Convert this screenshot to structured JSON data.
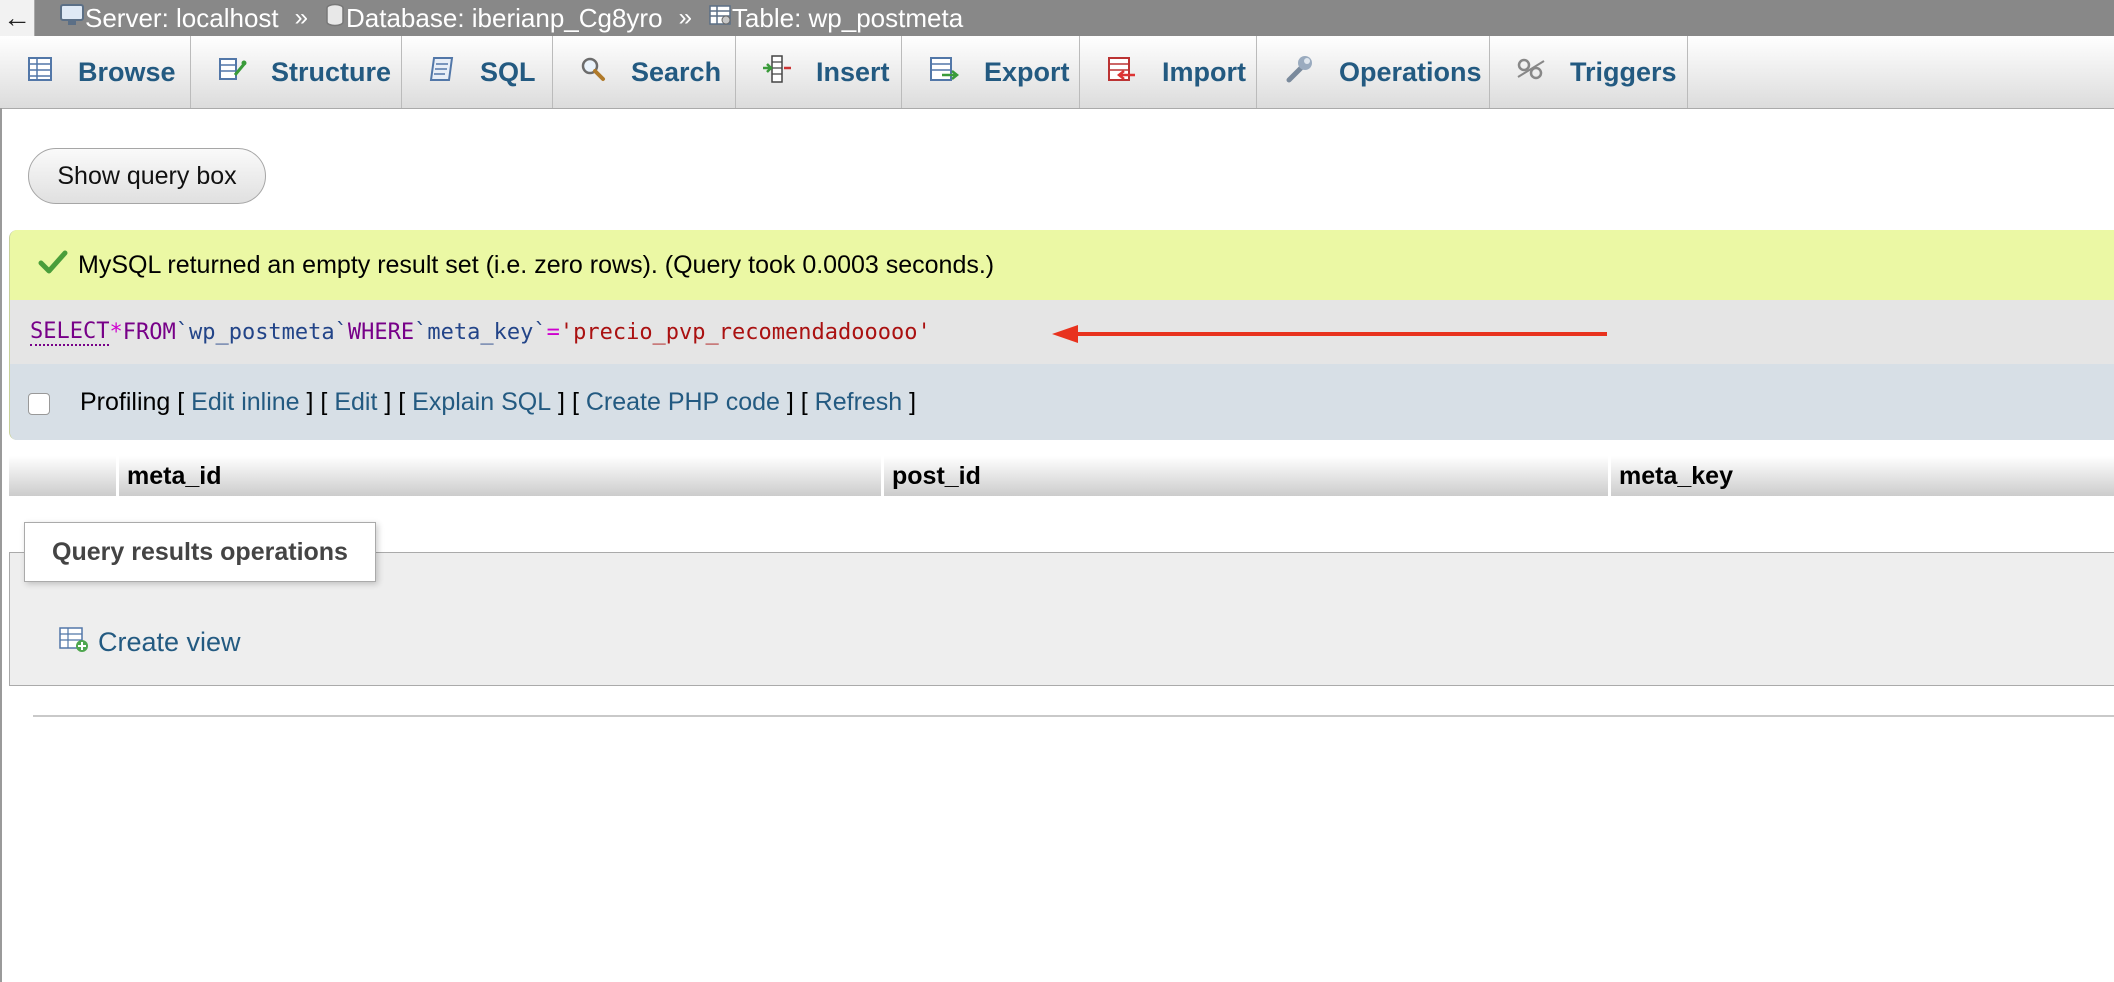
{
  "breadcrumb": {
    "back_glyph": "←",
    "separator": "»",
    "server": "Server: localhost",
    "database": "Database: iberianp_Cg8yro",
    "table": "Table: wp_postmeta"
  },
  "tabs": [
    {
      "label": "Browse",
      "icon": "browse-icon"
    },
    {
      "label": "Structure",
      "icon": "structure-icon"
    },
    {
      "label": "SQL",
      "icon": "sql-icon"
    },
    {
      "label": "Search",
      "icon": "search-icon"
    },
    {
      "label": "Insert",
      "icon": "insert-icon"
    },
    {
      "label": "Export",
      "icon": "export-icon"
    },
    {
      "label": "Import",
      "icon": "import-icon"
    },
    {
      "label": "Operations",
      "icon": "operations-icon"
    },
    {
      "label": "Triggers",
      "icon": "triggers-icon"
    }
  ],
  "show_query_button": "Show query box",
  "message": {
    "success_text": "MySQL returned an empty result set (i.e. zero rows). (Query took 0.0003 seconds.)",
    "status_color": "#ebf8a4"
  },
  "sql": {
    "select": "SELECT",
    "star": "*",
    "from": "FROM",
    "table": "`wp_postmeta`",
    "where": "WHERE",
    "column": "`meta_key`",
    "equals": "=",
    "value": "'precio_pvp_recomendadooooo'",
    "arrow_color": "#e8321e"
  },
  "profiling": {
    "label": "Profiling",
    "links": [
      "Edit inline",
      "Edit",
      "Explain SQL",
      "Create PHP code",
      "Refresh"
    ]
  },
  "table_headers": [
    "meta_id",
    "post_id",
    "meta_key"
  ],
  "query_results_operations": {
    "legend": "Query results operations",
    "create_view": "Create view"
  }
}
